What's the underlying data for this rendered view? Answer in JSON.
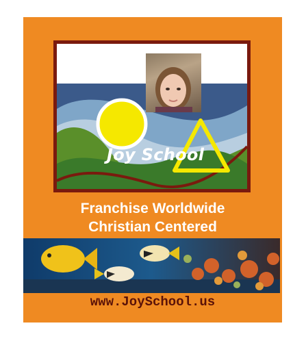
{
  "logo": {
    "title": "Joy School",
    "photo_description": "child-photo"
  },
  "taglines": {
    "line1": "Franchise Worldwide",
    "line2": "Christian Centered"
  },
  "banner": {
    "image": "coral-reef-fish"
  },
  "footer": {
    "url": "www.JoySchool.us"
  },
  "colors": {
    "background": "#ef8a22",
    "frame": "#7a1a0e",
    "navy": "#3b5a8a",
    "sun": "#f5e800",
    "url_text": "#5a1208"
  }
}
